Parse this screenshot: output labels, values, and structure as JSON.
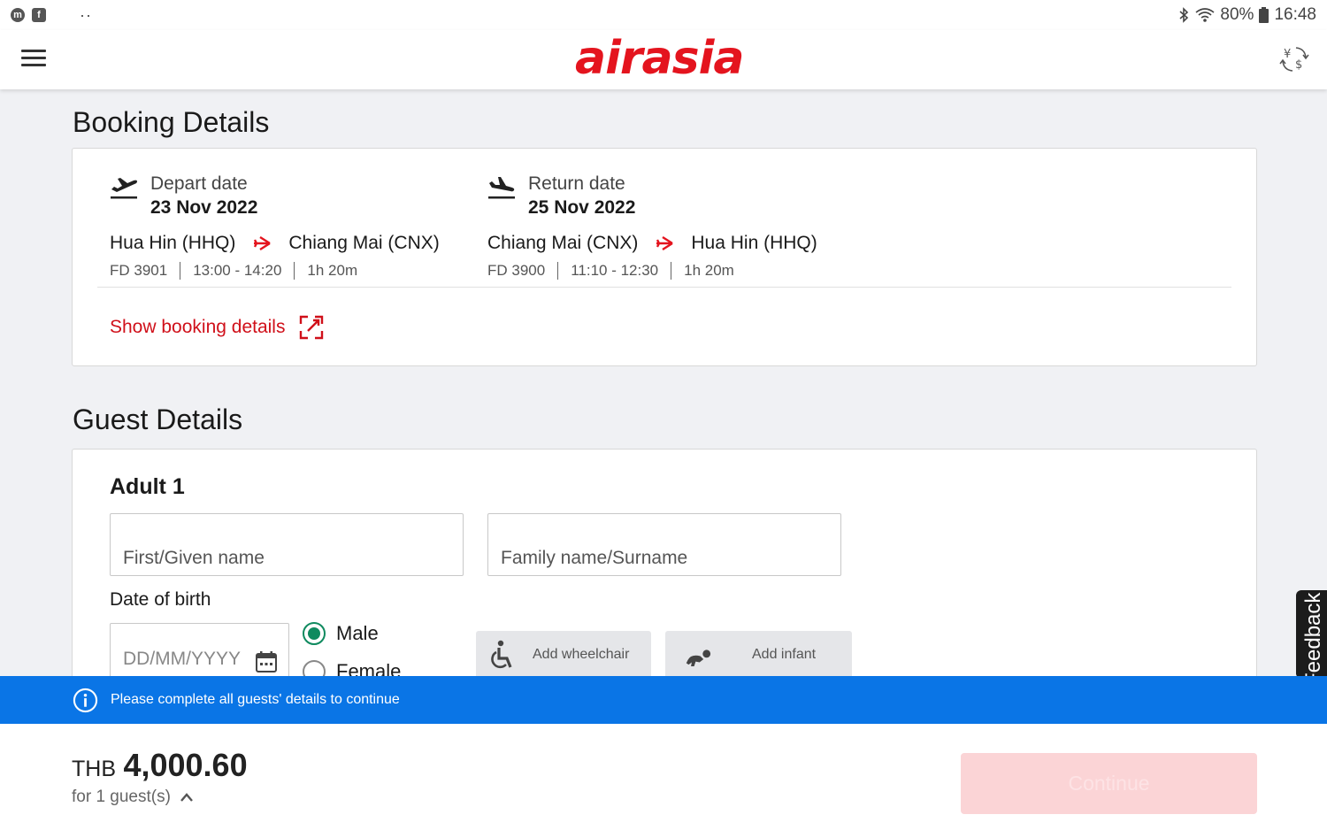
{
  "status_bar": {
    "battery": "80%",
    "time": "16:48",
    "dots": "··"
  },
  "header": {
    "logo_text": "airasia"
  },
  "booking": {
    "section_title": "Booking Details",
    "depart": {
      "label": "Depart date",
      "date": "23 Nov 2022",
      "from": "Hua Hin (HHQ)",
      "to": "Chiang Mai (CNX)",
      "flight_no": "FD 3901",
      "time": "13:00 - 14:20",
      "duration": "1h 20m"
    },
    "return": {
      "label": "Return date",
      "date": "25 Nov 2022",
      "from": "Chiang Mai (CNX)",
      "to": "Hua Hin (HHQ)",
      "flight_no": "FD 3900",
      "time": "11:10 - 12:30",
      "duration": "1h 20m"
    },
    "show_details_label": "Show booking details"
  },
  "guest": {
    "section_title": "Guest Details",
    "adult_title": "Adult 1",
    "first_name_placeholder": "First/Given name",
    "family_name_placeholder": "Family name/Surname",
    "dob_label": "Date of birth",
    "dob_placeholder": "DD/MM/YYYY",
    "gender_male": "Male",
    "gender_female": "Female",
    "selected_gender": "Male",
    "add_wheelchair": "Add wheelchair",
    "add_infant": "Add infant"
  },
  "feedback_label": "Feedback",
  "info_banner": {
    "text": "Please complete all guests' details to continue"
  },
  "footer": {
    "currency": "THB",
    "amount": "4,000.60",
    "guests_text": "for 1 guest(s)",
    "continue_label": "Continue"
  },
  "colors": {
    "brand_red": "#e4141e",
    "info_blue": "#0a75e6",
    "radio_green": "#0f8a5f",
    "continue_disabled": "#fbd4d6"
  }
}
